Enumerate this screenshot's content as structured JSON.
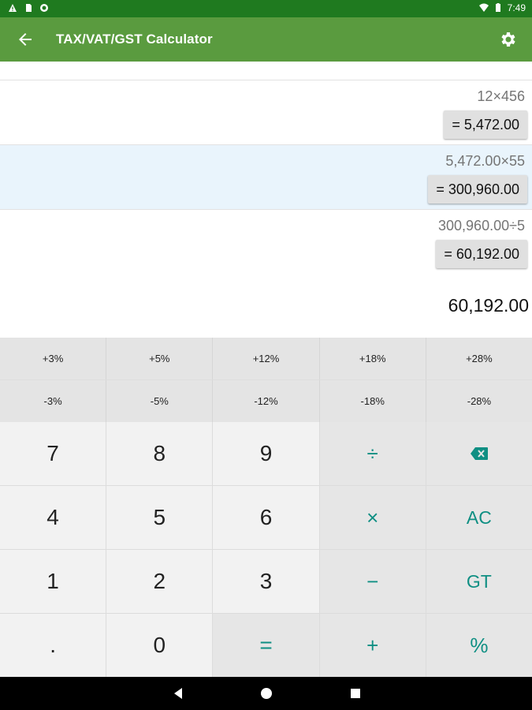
{
  "status_bar": {
    "time": "7:49",
    "left_icons": [
      "warning-icon",
      "sim-icon",
      "sync-icon"
    ],
    "right_icons": [
      "wifi-icon",
      "battery-icon"
    ]
  },
  "app_bar": {
    "title": "TAX/VAT/GST Calculator",
    "color": "#5a9b3f",
    "back_icon": "arrow-back-icon",
    "settings_icon": "gear-icon"
  },
  "history": [
    {
      "expression": "12×456",
      "result": "= 5,472.00"
    },
    {
      "expression": "5,472.00×55",
      "result": "= 300,960.00"
    },
    {
      "expression": "300,960.00÷5",
      "result": "= 60,192.00"
    }
  ],
  "display": {
    "value": "60,192.00"
  },
  "keypad": {
    "tax_add": [
      "+3%",
      "+5%",
      "+12%",
      "+18%",
      "+28%"
    ],
    "tax_subtract": [
      "-3%",
      "-5%",
      "-12%",
      "-18%",
      "-28%"
    ],
    "keys": [
      [
        "7",
        "8",
        "9",
        "÷",
        "⌫"
      ],
      [
        "4",
        "5",
        "6",
        "×",
        "AC"
      ],
      [
        "1",
        "2",
        "3",
        "−",
        "GT"
      ],
      [
        ".",
        "0",
        "=",
        "+",
        "%"
      ]
    ],
    "accent_color": "#0f8f83"
  },
  "nav_bar": {
    "icons": [
      "nav-back-icon",
      "nav-home-icon",
      "nav-recents-icon"
    ]
  }
}
